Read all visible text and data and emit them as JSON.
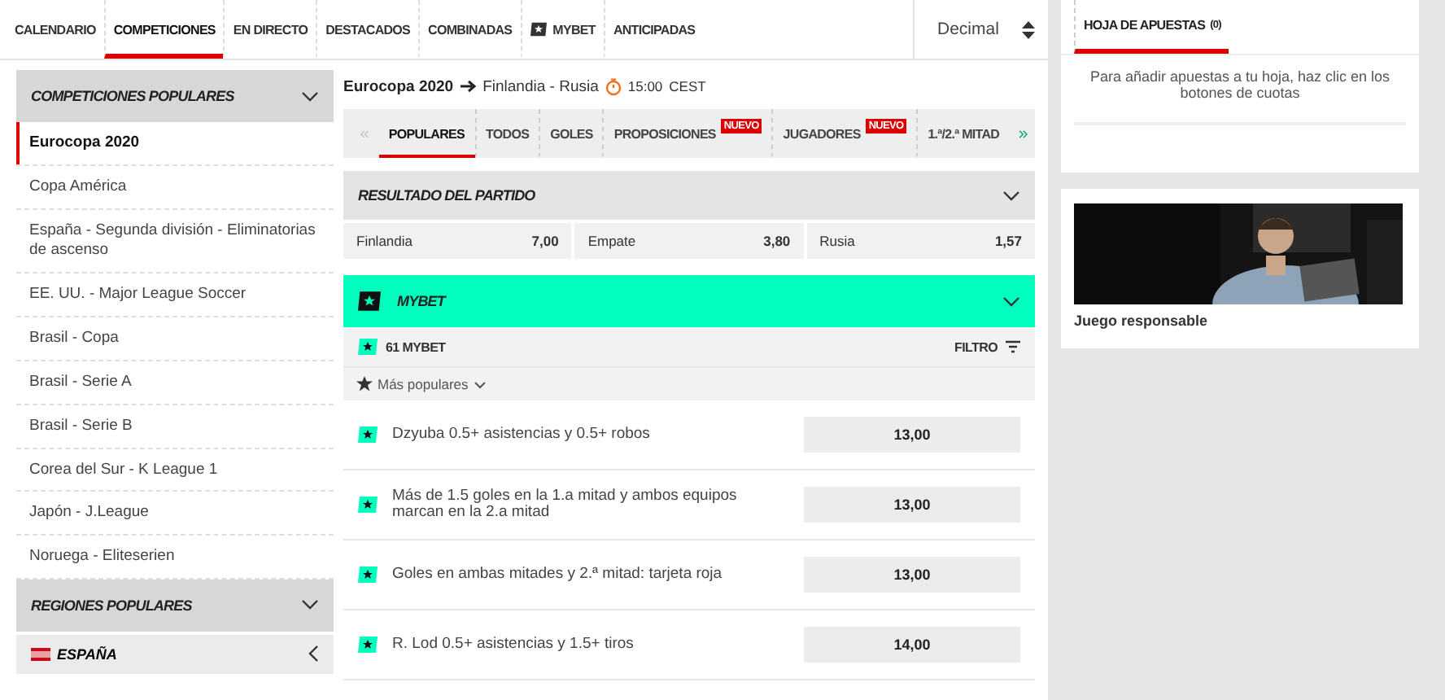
{
  "top_nav": {
    "items": [
      {
        "label": "CALENDARIO",
        "selected": false,
        "kind": "plain"
      },
      {
        "label": "COMPETICIONES",
        "selected": true,
        "kind": "plain"
      },
      {
        "label": "EN DIRECTO",
        "selected": false,
        "kind": "plain"
      },
      {
        "label": "DESTACADOS",
        "selected": false,
        "kind": "plain"
      },
      {
        "label": "COMBINADAS",
        "selected": false,
        "kind": "plain"
      },
      {
        "label": "MYBET",
        "selected": false,
        "kind": "mybet"
      },
      {
        "label": "ANTICIPADAS",
        "selected": false,
        "kind": "plain"
      }
    ],
    "odds_format": "Decimal"
  },
  "sidebar": {
    "sections": [
      {
        "title": "COMPETICIONES POPULARES",
        "expanded": true,
        "items": [
          {
            "label": "Eurocopa 2020",
            "selected": true
          },
          {
            "label": "Copa América",
            "selected": false
          },
          {
            "label": "España - Segunda división - Eliminatorias de ascenso",
            "selected": false
          },
          {
            "label": "EE. UU. - Major League Soccer",
            "selected": false
          },
          {
            "label": "Brasil - Copa",
            "selected": false
          },
          {
            "label": "Brasil - Serie A",
            "selected": false
          },
          {
            "label": "Brasil - Serie B",
            "selected": false
          },
          {
            "label": "Corea del Sur - K League 1",
            "selected": false
          },
          {
            "label": "Japón - J.League",
            "selected": false
          },
          {
            "label": "Noruega - Eliteserien",
            "selected": false
          }
        ]
      },
      {
        "title": "REGIONES POPULARES",
        "expanded": true,
        "regions": [
          {
            "label": "ESPAÑA",
            "expanded": false
          }
        ]
      }
    ]
  },
  "breadcrumb": {
    "competition": "Eurocopa 2020",
    "event": "Finlandia - Rusia",
    "time": "15:00",
    "timezone": "CEST"
  },
  "market_tabs": [
    {
      "label": "POPULARES",
      "selected": true
    },
    {
      "label": "TODOS",
      "selected": false
    },
    {
      "label": "GOLES",
      "selected": false
    },
    {
      "label": "PROPOSICIONES",
      "selected": false,
      "badge": "NUEVO"
    },
    {
      "label": "JUGADORES",
      "selected": false,
      "badge": "NUEVO"
    },
    {
      "label": "1.ª/2.ª MITAD",
      "selected": false
    }
  ],
  "match_result": {
    "title": "RESULTADO DEL PARTIDO",
    "expanded": true,
    "outcomes": [
      {
        "label": "Finlandia",
        "odds": "7,00"
      },
      {
        "label": "Empate",
        "odds": "3,80"
      },
      {
        "label": "Rusia",
        "odds": "1,57"
      }
    ]
  },
  "mybet": {
    "title": "MYBET",
    "expanded": true,
    "count": "61 MYBET",
    "filter": "FILTRO",
    "sort": "Más populares",
    "bets": [
      {
        "label": "Dzyuba 0.5+ asistencias y 0.5+ robos",
        "odds": "13,00"
      },
      {
        "label": "Más de 1.5 goles en la 1.a mitad y ambos equipos marcan en la 2.a mitad",
        "odds": "13,00"
      },
      {
        "label": "Goles en ambas mitades y 2.ª mitad: tarjeta roja",
        "odds": "13,00"
      },
      {
        "label": "R. Lod 0.5+ asistencias y 1.5+ tiros",
        "odds": "14,00"
      }
    ]
  },
  "bet_slip": {
    "title": "HOJA DE APUESTAS",
    "count": "(0)",
    "selected": true,
    "message": "Para añadir apuestas a tu hoja, haz clic en los botones de cuotas"
  },
  "promo": {
    "kind": "picture",
    "caption": "Juego responsable"
  }
}
